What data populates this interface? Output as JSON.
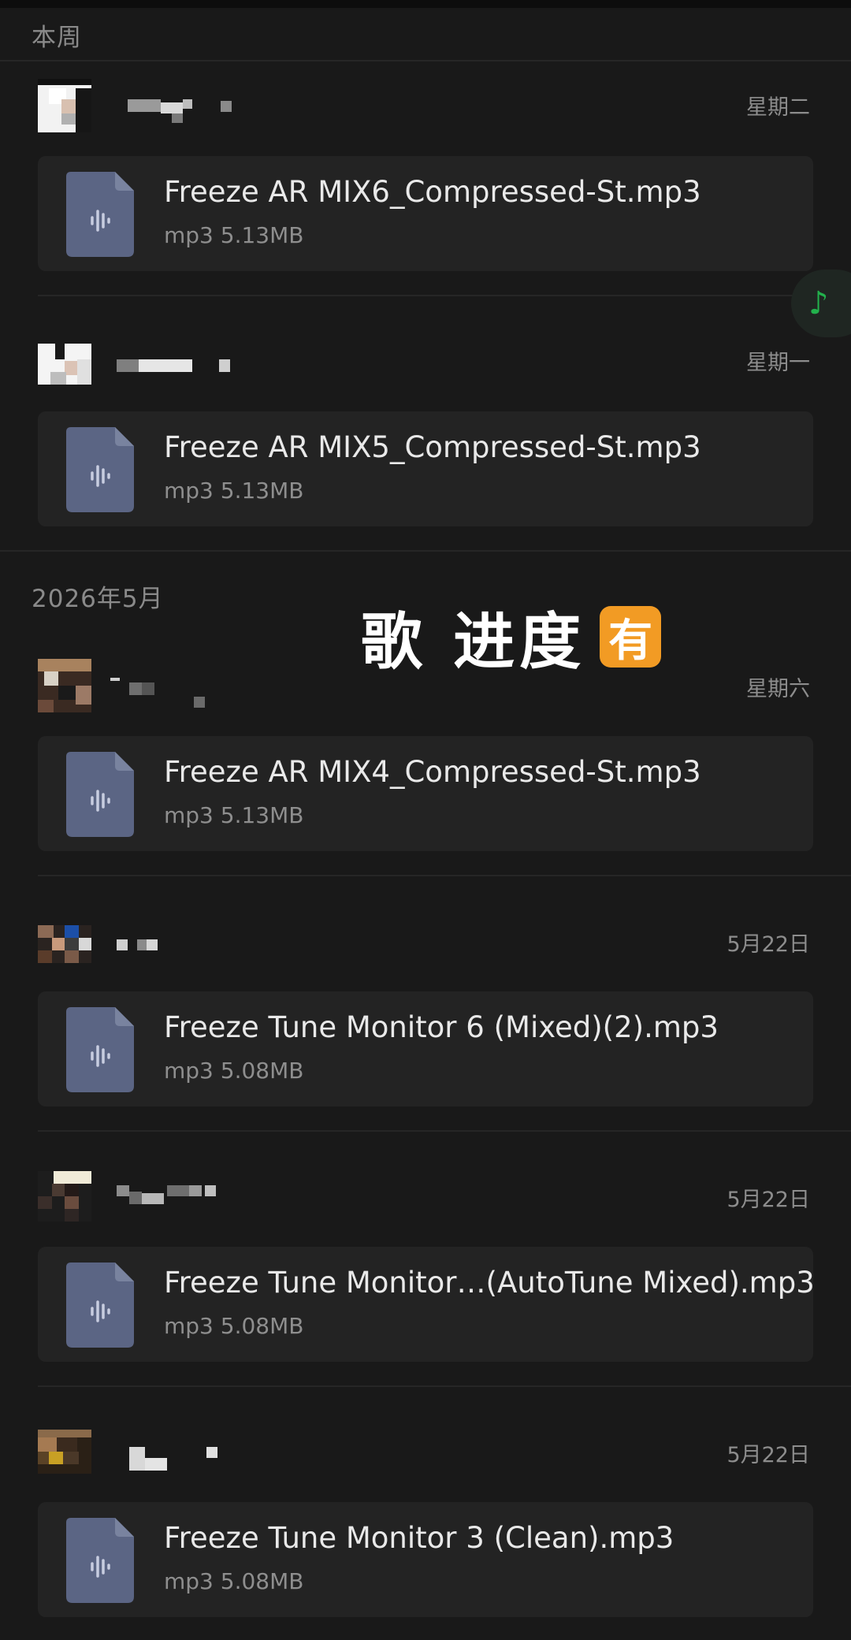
{
  "sections": {
    "this_week": "本周",
    "may_2026": "2026年5月"
  },
  "overlay": {
    "text": "歌 进度",
    "badge": "有"
  },
  "music_fab": {
    "icon": "music-note-icon",
    "glyph": "♪",
    "color": "#22b14c"
  },
  "entries": [
    {
      "date": "星期二",
      "file": {
        "name": "Freeze AR MIX6_Compressed-St.mp3",
        "meta": "mp3 5.13MB"
      }
    },
    {
      "date": "星期一",
      "file": {
        "name": "Freeze AR MIX5_Compressed-St.mp3",
        "meta": "mp3 5.13MB"
      }
    },
    {
      "date": "星期六",
      "file": {
        "name": "Freeze AR MIX4_Compressed-St.mp3",
        "meta": "mp3 5.13MB"
      }
    },
    {
      "date": "5月22日",
      "file": {
        "name": "Freeze Tune Monitor 6 (Mixed)(2).mp3",
        "meta": "mp3 5.08MB"
      }
    },
    {
      "date": "5月22日",
      "file": {
        "name": "Freeze Tune Monitor…(AutoTune Mixed).mp3",
        "meta": "mp3 5.08MB"
      }
    },
    {
      "date": "5月22日",
      "file": {
        "name": "Freeze Tune Monitor 3 (Clean).mp3",
        "meta": "mp3 5.08MB"
      }
    }
  ],
  "colors": {
    "background": "#191919",
    "card": "#232323",
    "file_icon": "#5b6584",
    "overlay_badge": "#f29b24"
  }
}
